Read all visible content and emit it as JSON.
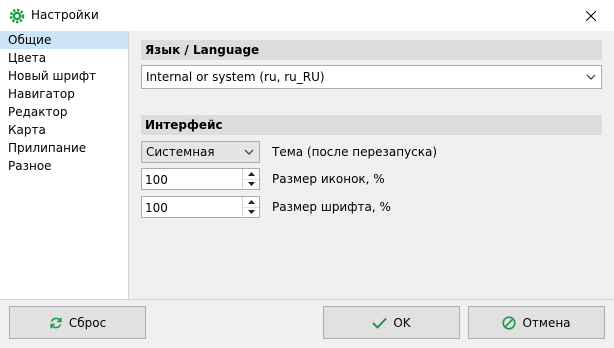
{
  "window": {
    "title": "Настройки",
    "app_icon": "gear-icon",
    "close_icon": "close-icon"
  },
  "sidebar": {
    "selected_index": 0,
    "items": [
      {
        "label": "Общие"
      },
      {
        "label": "Цвета"
      },
      {
        "label": "Новый шрифт"
      },
      {
        "label": "Навигатор"
      },
      {
        "label": "Редактор"
      },
      {
        "label": "Карта"
      },
      {
        "label": "Прилипание"
      },
      {
        "label": "Разное"
      }
    ]
  },
  "language_section": {
    "header": "Язык / Language",
    "selected": "Internal or system (ru, ru_RU)"
  },
  "interface_section": {
    "header": "Интерфейс",
    "theme": {
      "value": "Системная",
      "label": "Тема (после перезапуска)"
    },
    "icon_size": {
      "value": "100",
      "label": "Размер иконок, %"
    },
    "font_size": {
      "value": "100",
      "label": "Размер шрифта, %"
    }
  },
  "buttons": {
    "reset": {
      "label": "Сброс",
      "icon": "refresh-icon"
    },
    "ok": {
      "label": "OK",
      "icon": "check-icon"
    },
    "cancel": {
      "label": "Отмена",
      "icon": "cancel-icon"
    }
  },
  "colors": {
    "selection": "#cce4f7",
    "accent_green": "#1a9a4a"
  }
}
